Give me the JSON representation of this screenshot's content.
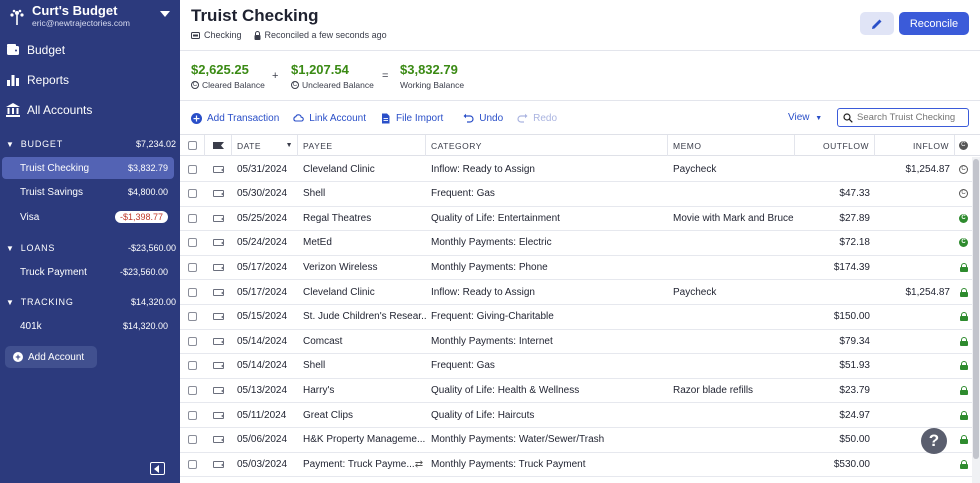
{
  "sidebar": {
    "budget_name": "Curt's Budget",
    "email": "eric@newtrajectories.com",
    "nav": [
      {
        "label": "Budget"
      },
      {
        "label": "Reports"
      },
      {
        "label": "All Accounts"
      }
    ],
    "groups": {
      "budget": {
        "label": "BUDGET",
        "amount": "$7,234.02"
      },
      "loans": {
        "label": "LOANS",
        "amount": "-$23,560.00"
      },
      "tracking": {
        "label": "TRACKING",
        "amount": "$14,320.00"
      }
    },
    "accounts": {
      "truist_checking": {
        "name": "Truist Checking",
        "amount": "$3,832.79"
      },
      "truist_savings": {
        "name": "Truist Savings",
        "amount": "$4,800.00"
      },
      "visa": {
        "name": "Visa",
        "amount": "-$1,398.77"
      },
      "truck_payment": {
        "name": "Truck Payment",
        "amount": "-$23,560.00"
      },
      "k401": {
        "name": "401k",
        "amount": "$14,320.00"
      }
    },
    "add_account": "Add Account"
  },
  "header": {
    "title": "Truist Checking",
    "account_type": "Checking",
    "reconciled": "Reconciled a few seconds ago",
    "reconcile_label": "Reconcile"
  },
  "balances": {
    "cleared": {
      "value": "$2,625.25",
      "label": "Cleared Balance"
    },
    "uncleared": {
      "value": "$1,207.54",
      "label": "Uncleared Balance"
    },
    "working": {
      "value": "$3,832.79",
      "label": "Working Balance"
    },
    "plus": "+",
    "equals": "="
  },
  "toolbar": {
    "add_transaction": "Add Transaction",
    "link_account": "Link Account",
    "file_import": "File Import",
    "undo": "Undo",
    "redo": "Redo",
    "view": "View",
    "search_placeholder": "Search Truist Checking"
  },
  "table": {
    "columns": {
      "date": "DATE",
      "payee": "PAYEE",
      "category": "CATEGORY",
      "memo": "MEMO",
      "outflow": "OUTFLOW",
      "inflow": "INFLOW"
    },
    "rows": [
      {
        "date": "05/31/2024",
        "payee": "Cleveland Clinic",
        "category": "Inflow: Ready to Assign",
        "memo": "Paycheck",
        "outflow": "",
        "inflow": "$1,254.87",
        "status": "cleared-outline"
      },
      {
        "date": "05/30/2024",
        "payee": "Shell",
        "category": "Frequent: Gas",
        "memo": "",
        "outflow": "$47.33",
        "inflow": "",
        "status": "cleared-outline"
      },
      {
        "date": "05/25/2024",
        "payee": "Regal Theatres",
        "category": "Quality of Life: Entertainment",
        "memo": "Movie with Mark and Bruce",
        "outflow": "$27.89",
        "inflow": "",
        "status": "cleared"
      },
      {
        "date": "05/24/2024",
        "payee": "MetEd",
        "category": "Monthly Payments: Electric",
        "memo": "",
        "outflow": "$72.18",
        "inflow": "",
        "status": "cleared"
      },
      {
        "date": "05/17/2024",
        "payee": "Verizon Wireless",
        "category": "Monthly Payments: Phone",
        "memo": "",
        "outflow": "$174.39",
        "inflow": "",
        "status": "reconciled"
      },
      {
        "date": "05/17/2024",
        "payee": "Cleveland Clinic",
        "category": "Inflow: Ready to Assign",
        "memo": "Paycheck",
        "outflow": "",
        "inflow": "$1,254.87",
        "status": "reconciled"
      },
      {
        "date": "05/15/2024",
        "payee": "St. Jude Children's Resear...",
        "category": "Frequent: Giving-Charitable",
        "memo": "",
        "outflow": "$150.00",
        "inflow": "",
        "status": "reconciled"
      },
      {
        "date": "05/14/2024",
        "payee": "Comcast",
        "category": "Monthly Payments: Internet",
        "memo": "",
        "outflow": "$79.34",
        "inflow": "",
        "status": "reconciled"
      },
      {
        "date": "05/14/2024",
        "payee": "Shell",
        "category": "Frequent: Gas",
        "memo": "",
        "outflow": "$51.93",
        "inflow": "",
        "status": "reconciled"
      },
      {
        "date": "05/13/2024",
        "payee": "Harry's",
        "category": "Quality of Life: Health & Wellness",
        "memo": "Razor blade refills",
        "outflow": "$23.79",
        "inflow": "",
        "status": "reconciled"
      },
      {
        "date": "05/11/2024",
        "payee": "Great Clips",
        "category": "Quality of Life: Haircuts",
        "memo": "",
        "outflow": "$24.97",
        "inflow": "",
        "status": "reconciled"
      },
      {
        "date": "05/06/2024",
        "payee": "H&K Property Manageme...",
        "category": "Monthly Payments: Water/Sewer/Trash",
        "memo": "",
        "outflow": "$50.00",
        "inflow": "",
        "status": "reconciled"
      },
      {
        "date": "05/03/2024",
        "payee": "Payment: Truck Payme...",
        "category": "Monthly Payments: Truck Payment",
        "memo": "",
        "outflow": "$530.00",
        "inflow": "",
        "status": "reconciled",
        "transfer": true
      }
    ]
  },
  "colors": {
    "sidebar_bg": "#2c3a7d",
    "accent": "#3b5bd9",
    "positive": "#3a8a14",
    "negative": "#c0392b"
  }
}
